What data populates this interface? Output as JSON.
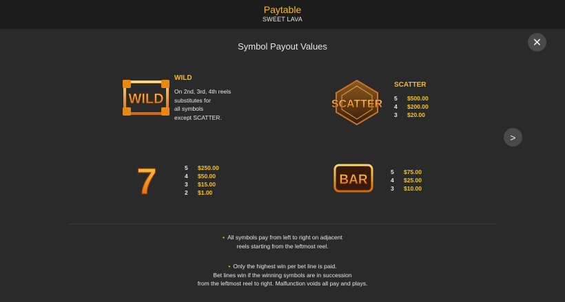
{
  "header": {
    "title": "Paytable",
    "subtitle": "SWEET LAVA"
  },
  "section_title": "Symbol Payout Values",
  "icons": {
    "close": "close-icon",
    "next": "chevron-right-icon"
  },
  "wild": {
    "label": "WILD",
    "symbol_text": "WILD",
    "description": [
      "On 2nd, 3rd, 4th reels",
      "substitutes for",
      "all symbols",
      "except SCATTER."
    ]
  },
  "scatter": {
    "label": "SCATTER",
    "symbol_text": "SCATTER",
    "payouts": [
      {
        "count": "5",
        "amount": "$500.00"
      },
      {
        "count": "4",
        "amount": "$200.00"
      },
      {
        "count": "3",
        "amount": "$20.00"
      }
    ]
  },
  "seven": {
    "symbol_text": "7",
    "payouts": [
      {
        "count": "5",
        "amount": "$250.00"
      },
      {
        "count": "4",
        "amount": "$50.00"
      },
      {
        "count": "3",
        "amount": "$15.00"
      },
      {
        "count": "2",
        "amount": "$1.00"
      }
    ]
  },
  "bar": {
    "symbol_text": "BAR",
    "payouts": [
      {
        "count": "5",
        "amount": "$75.00"
      },
      {
        "count": "4",
        "amount": "$25.00"
      },
      {
        "count": "3",
        "amount": "$10.00"
      }
    ]
  },
  "rules": [
    {
      "bullet": "•",
      "lines": [
        "All symbols pay from left to right on adjacent",
        "reels starting from the leftmost reel."
      ]
    },
    {
      "bullet": "•",
      "lines": [
        "Only the highest win per bet line is paid.",
        "Bet lines win if the winning symbols are in succession",
        "from the leftmost reel to right. Malfunction voids all pay and plays."
      ]
    }
  ],
  "colors": {
    "accent": "#f5b82e",
    "amount": "#f5c518",
    "background": "#2a2a2a",
    "header": "#1c1c1c"
  }
}
